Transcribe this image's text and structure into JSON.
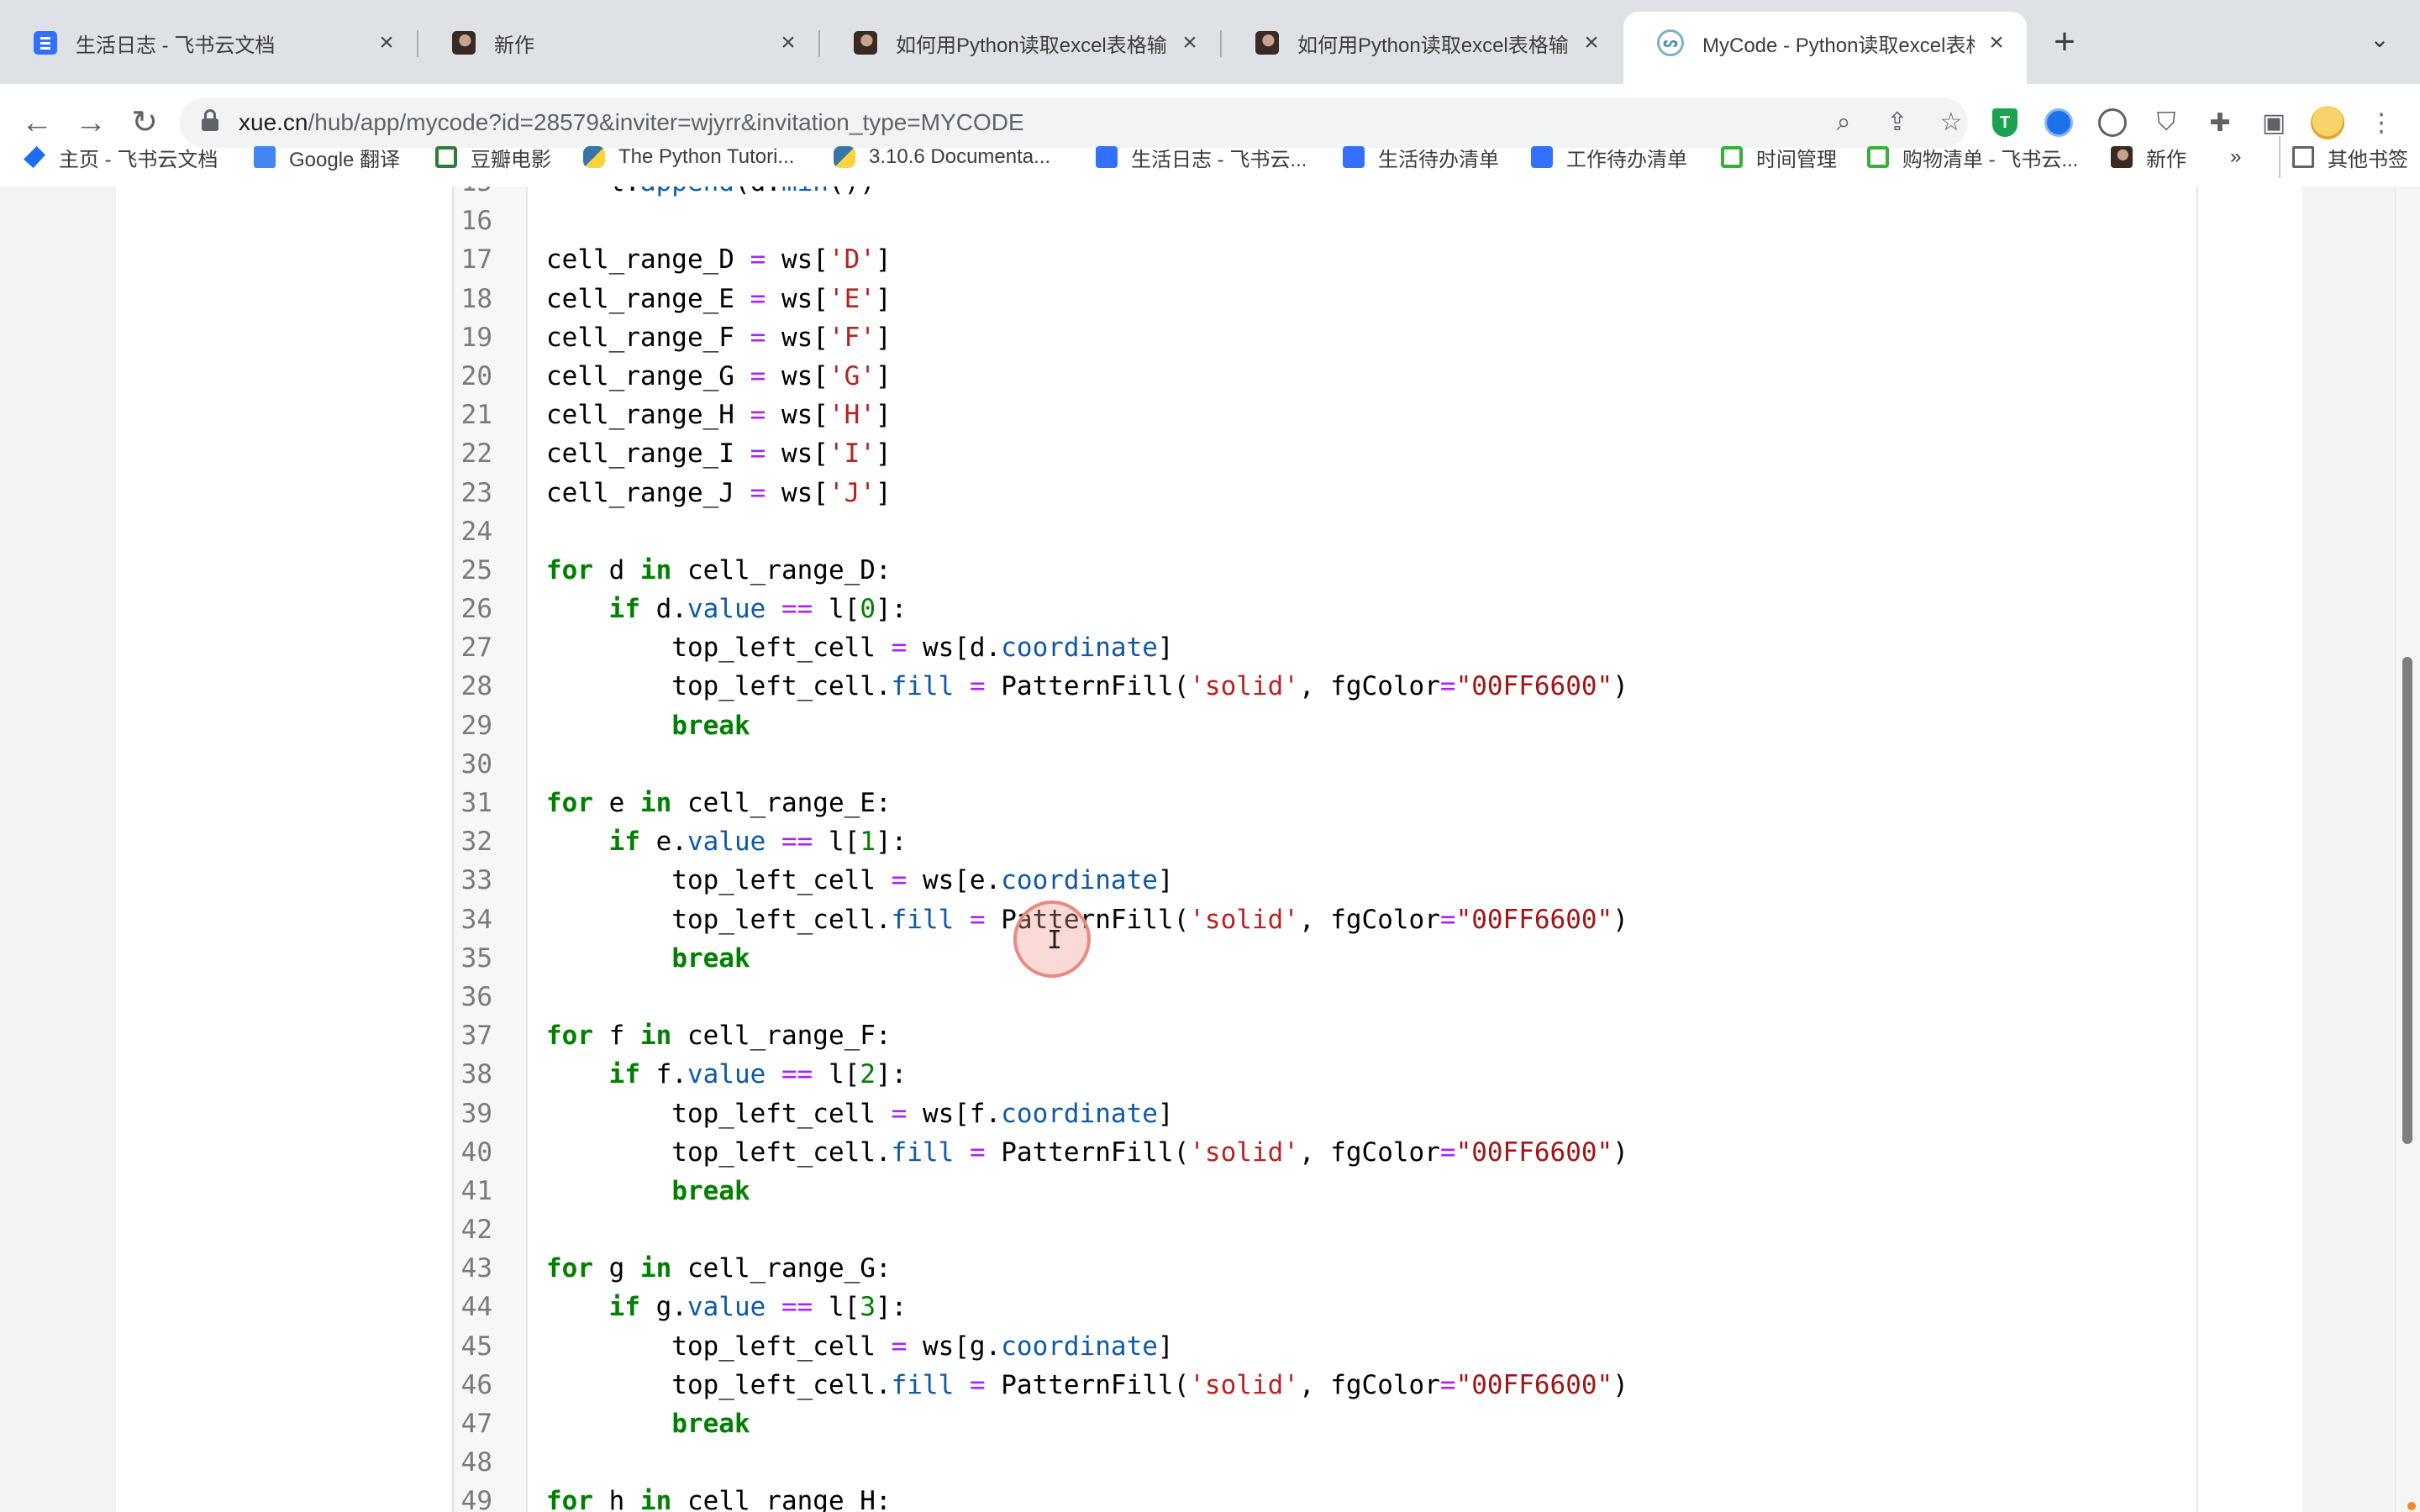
{
  "tabs": [
    {
      "title": "生活日志 - 飞书云文档",
      "icon": "doc-icon"
    },
    {
      "title": "新作",
      "icon": "avatar-icon"
    },
    {
      "title": "如何用Python读取excel表格输出",
      "icon": "avatar-icon"
    },
    {
      "title": "如何用Python读取excel表格输出",
      "icon": "avatar-icon"
    },
    {
      "title": "MyCode - Python读取excel表格",
      "icon": "mycode-icon",
      "active": true
    }
  ],
  "address_bar": {
    "host": "xue.cn",
    "path": "/hub/app/mycode?id=28579&inviter=wjyrr&invitation_type=MYCODE"
  },
  "bookmarks": [
    {
      "label": "主页 - 飞书云文档",
      "icon": "feishu-icon"
    },
    {
      "label": "Google 翻译",
      "icon": "google-translate-icon"
    },
    {
      "label": "豆瓣电影",
      "icon": "douban-icon"
    },
    {
      "label": "The Python Tutori...",
      "icon": "python-icon"
    },
    {
      "label": "3.10.6 Documenta...",
      "icon": "python-icon"
    },
    {
      "label": "生活日志 - 飞书云...",
      "icon": "doc-icon"
    },
    {
      "label": "生活待办清单",
      "icon": "doc-icon"
    },
    {
      "label": "工作待办清单",
      "icon": "doc-icon"
    },
    {
      "label": "时间管理",
      "icon": "sheet-icon"
    },
    {
      "label": "购物清单 - 飞书云...",
      "icon": "sheet-icon"
    },
    {
      "label": "新作",
      "icon": "avatar-icon"
    }
  ],
  "bookmarks_overflow": "»",
  "other_bookmarks": "其他书签",
  "code_lines": [
    {
      "n": "15",
      "tokens": [
        [
          "    l.",
          ""
        ],
        [
          "append",
          "attr"
        ],
        [
          "(d.",
          ""
        ],
        [
          "min",
          "attr"
        ],
        [
          "())",
          ""
        ]
      ]
    },
    {
      "n": "16",
      "tokens": []
    },
    {
      "n": "17",
      "tokens": [
        [
          "cell_range_D ",
          ""
        ],
        [
          "=",
          "op"
        ],
        [
          " ws[",
          ""
        ],
        [
          "'D'",
          "str"
        ],
        [
          "]",
          ""
        ]
      ]
    },
    {
      "n": "18",
      "tokens": [
        [
          "cell_range_E ",
          ""
        ],
        [
          "=",
          "op"
        ],
        [
          " ws[",
          ""
        ],
        [
          "'E'",
          "str"
        ],
        [
          "]",
          ""
        ]
      ]
    },
    {
      "n": "19",
      "tokens": [
        [
          "cell_range_F ",
          ""
        ],
        [
          "=",
          "op"
        ],
        [
          " ws[",
          ""
        ],
        [
          "'F'",
          "str"
        ],
        [
          "]",
          ""
        ]
      ]
    },
    {
      "n": "20",
      "tokens": [
        [
          "cell_range_G ",
          ""
        ],
        [
          "=",
          "op"
        ],
        [
          " ws[",
          ""
        ],
        [
          "'G'",
          "str"
        ],
        [
          "]",
          ""
        ]
      ]
    },
    {
      "n": "21",
      "tokens": [
        [
          "cell_range_H ",
          ""
        ],
        [
          "=",
          "op"
        ],
        [
          " ws[",
          ""
        ],
        [
          "'H'",
          "str"
        ],
        [
          "]",
          ""
        ]
      ]
    },
    {
      "n": "22",
      "tokens": [
        [
          "cell_range_I ",
          ""
        ],
        [
          "=",
          "op"
        ],
        [
          " ws[",
          ""
        ],
        [
          "'I'",
          "str"
        ],
        [
          "]",
          ""
        ]
      ]
    },
    {
      "n": "23",
      "tokens": [
        [
          "cell_range_J ",
          ""
        ],
        [
          "=",
          "op"
        ],
        [
          " ws[",
          ""
        ],
        [
          "'J'",
          "str"
        ],
        [
          "]",
          ""
        ]
      ]
    },
    {
      "n": "24",
      "tokens": []
    },
    {
      "n": "25",
      "tokens": [
        [
          "for",
          "kw"
        ],
        [
          " d ",
          ""
        ],
        [
          "in",
          "kw"
        ],
        [
          " cell_range_D:",
          ""
        ]
      ]
    },
    {
      "n": "26",
      "tokens": [
        [
          "    ",
          ""
        ],
        [
          "if",
          "kw"
        ],
        [
          " d.",
          ""
        ],
        [
          "value",
          "attr"
        ],
        [
          " ",
          ""
        ],
        [
          "==",
          "op"
        ],
        [
          " l[",
          ""
        ],
        [
          "0",
          "num"
        ],
        [
          "]:",
          ""
        ]
      ]
    },
    {
      "n": "27",
      "tokens": [
        [
          "        top_left_cell ",
          ""
        ],
        [
          "=",
          "op"
        ],
        [
          " ws[d.",
          ""
        ],
        [
          "coordinate",
          "attr"
        ],
        [
          "]",
          ""
        ]
      ]
    },
    {
      "n": "28",
      "tokens": [
        [
          "        top_left_cell.",
          ""
        ],
        [
          "fill",
          "attr"
        ],
        [
          " ",
          ""
        ],
        [
          "=",
          "op"
        ],
        [
          " PatternFill(",
          ""
        ],
        [
          "'solid'",
          "str"
        ],
        [
          ", fgColor",
          ""
        ],
        [
          "=",
          "op"
        ],
        [
          "\"00FF6600\"",
          "dstr"
        ],
        [
          ")",
          ""
        ]
      ]
    },
    {
      "n": "29",
      "tokens": [
        [
          "        ",
          ""
        ],
        [
          "break",
          "kw"
        ]
      ]
    },
    {
      "n": "30",
      "tokens": []
    },
    {
      "n": "31",
      "tokens": [
        [
          "for",
          "kw"
        ],
        [
          " e ",
          ""
        ],
        [
          "in",
          "kw"
        ],
        [
          " cell_range_E:",
          ""
        ]
      ]
    },
    {
      "n": "32",
      "tokens": [
        [
          "    ",
          ""
        ],
        [
          "if",
          "kw"
        ],
        [
          " e.",
          ""
        ],
        [
          "value",
          "attr"
        ],
        [
          " ",
          ""
        ],
        [
          "==",
          "op"
        ],
        [
          " l[",
          ""
        ],
        [
          "1",
          "num"
        ],
        [
          "]:",
          ""
        ]
      ]
    },
    {
      "n": "33",
      "tokens": [
        [
          "        top_left_cell ",
          ""
        ],
        [
          "=",
          "op"
        ],
        [
          " ws[e.",
          ""
        ],
        [
          "coordinate",
          "attr"
        ],
        [
          "]",
          ""
        ]
      ]
    },
    {
      "n": "34",
      "tokens": [
        [
          "        top_left_cell.",
          ""
        ],
        [
          "fill",
          "attr"
        ],
        [
          " ",
          ""
        ],
        [
          "=",
          "op"
        ],
        [
          " PatternFill(",
          ""
        ],
        [
          "'solid'",
          "str"
        ],
        [
          ", fgColor",
          ""
        ],
        [
          "=",
          "op"
        ],
        [
          "\"00FF6600\"",
          "dstr"
        ],
        [
          ")",
          ""
        ]
      ]
    },
    {
      "n": "35",
      "tokens": [
        [
          "        ",
          ""
        ],
        [
          "break",
          "kw"
        ]
      ]
    },
    {
      "n": "36",
      "tokens": []
    },
    {
      "n": "37",
      "tokens": [
        [
          "for",
          "kw"
        ],
        [
          " f ",
          ""
        ],
        [
          "in",
          "kw"
        ],
        [
          " cell_range_F:",
          ""
        ]
      ]
    },
    {
      "n": "38",
      "tokens": [
        [
          "    ",
          ""
        ],
        [
          "if",
          "kw"
        ],
        [
          " f.",
          ""
        ],
        [
          "value",
          "attr"
        ],
        [
          " ",
          ""
        ],
        [
          "==",
          "op"
        ],
        [
          " l[",
          ""
        ],
        [
          "2",
          "num"
        ],
        [
          "]:",
          ""
        ]
      ]
    },
    {
      "n": "39",
      "tokens": [
        [
          "        top_left_cell ",
          ""
        ],
        [
          "=",
          "op"
        ],
        [
          " ws[f.",
          ""
        ],
        [
          "coordinate",
          "attr"
        ],
        [
          "]",
          ""
        ]
      ]
    },
    {
      "n": "40",
      "tokens": [
        [
          "        top_left_cell.",
          ""
        ],
        [
          "fill",
          "attr"
        ],
        [
          " ",
          ""
        ],
        [
          "=",
          "op"
        ],
        [
          " PatternFill(",
          ""
        ],
        [
          "'solid'",
          "str"
        ],
        [
          ", fgColor",
          ""
        ],
        [
          "=",
          "op"
        ],
        [
          "\"00FF6600\"",
          "dstr"
        ],
        [
          ")",
          ""
        ]
      ]
    },
    {
      "n": "41",
      "tokens": [
        [
          "        ",
          ""
        ],
        [
          "break",
          "kw"
        ]
      ]
    },
    {
      "n": "42",
      "tokens": []
    },
    {
      "n": "43",
      "tokens": [
        [
          "for",
          "kw"
        ],
        [
          " g ",
          ""
        ],
        [
          "in",
          "kw"
        ],
        [
          " cell_range_G:",
          ""
        ]
      ]
    },
    {
      "n": "44",
      "tokens": [
        [
          "    ",
          ""
        ],
        [
          "if",
          "kw"
        ],
        [
          " g.",
          ""
        ],
        [
          "value",
          "attr"
        ],
        [
          " ",
          ""
        ],
        [
          "==",
          "op"
        ],
        [
          " l[",
          ""
        ],
        [
          "3",
          "num"
        ],
        [
          "]:",
          ""
        ]
      ]
    },
    {
      "n": "45",
      "tokens": [
        [
          "        top_left_cell ",
          ""
        ],
        [
          "=",
          "op"
        ],
        [
          " ws[g.",
          ""
        ],
        [
          "coordinate",
          "attr"
        ],
        [
          "]",
          ""
        ]
      ]
    },
    {
      "n": "46",
      "tokens": [
        [
          "        top_left_cell.",
          ""
        ],
        [
          "fill",
          "attr"
        ],
        [
          " ",
          ""
        ],
        [
          "=",
          "op"
        ],
        [
          " PatternFill(",
          ""
        ],
        [
          "'solid'",
          "str"
        ],
        [
          ", fgColor",
          ""
        ],
        [
          "=",
          "op"
        ],
        [
          "\"00FF6600\"",
          "dstr"
        ],
        [
          ")",
          ""
        ]
      ]
    },
    {
      "n": "47",
      "tokens": [
        [
          "        ",
          ""
        ],
        [
          "break",
          "kw"
        ]
      ]
    },
    {
      "n": "48",
      "tokens": []
    },
    {
      "n": "49",
      "tokens": [
        [
          "for",
          "kw"
        ],
        [
          " h ",
          ""
        ],
        [
          "in",
          "kw"
        ],
        [
          " cell_range_H:",
          ""
        ]
      ]
    }
  ],
  "colors": {
    "keyword": "#008000",
    "operator": "#aa22ff",
    "string": "#ba2121",
    "attribute": "#0e5aa8"
  }
}
